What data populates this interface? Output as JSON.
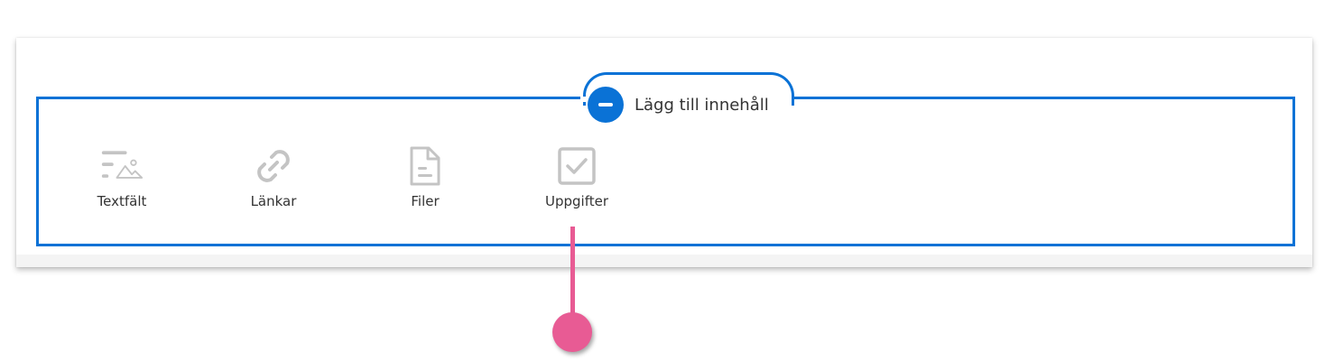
{
  "panel": {
    "toggle_label": "Lägg till innehåll",
    "toggle_icon": "minus-circle-icon",
    "accent_color": "#0a72d6"
  },
  "options": [
    {
      "label": "Textfält",
      "icon": "text-image-icon"
    },
    {
      "label": "Länkar",
      "icon": "link-icon"
    },
    {
      "label": "Filer",
      "icon": "file-icon"
    },
    {
      "label": "Uppgifter",
      "icon": "checkbox-icon"
    }
  ],
  "pointer": {
    "color": "#e85b94"
  }
}
